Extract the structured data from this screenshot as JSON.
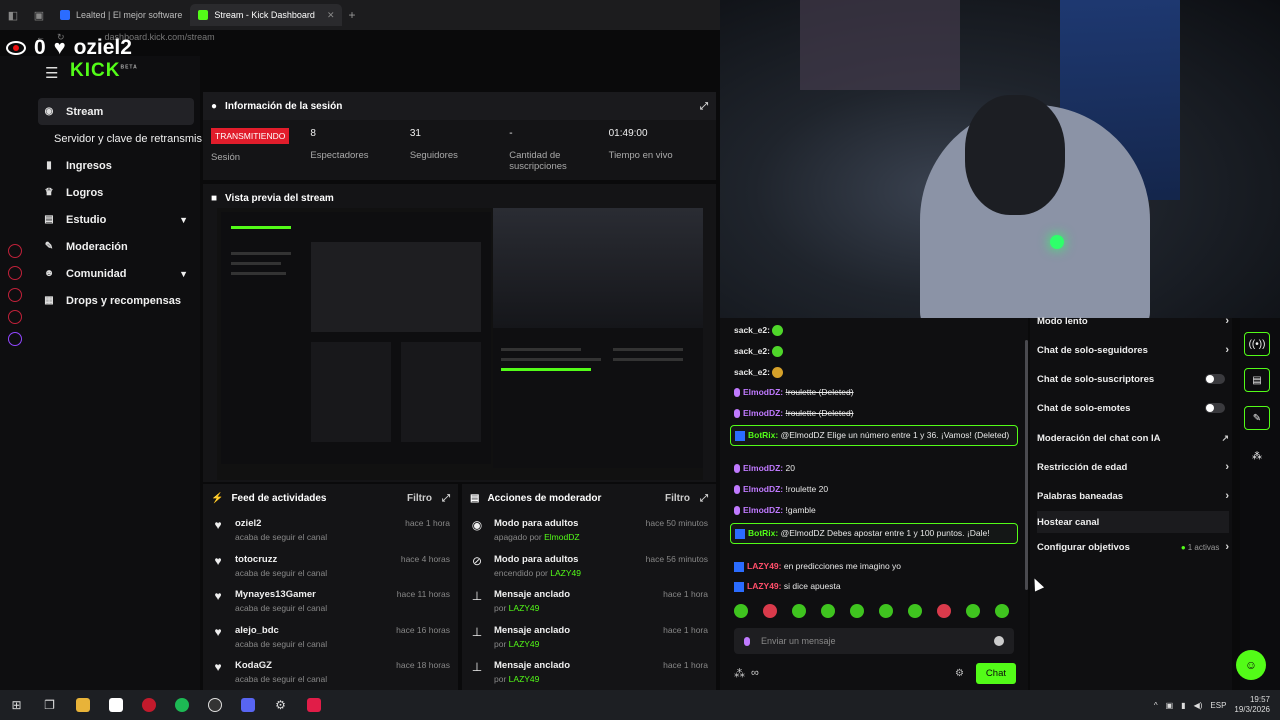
{
  "browser": {
    "tabs": [
      {
        "label": "Lealted | El mejor software"
      },
      {
        "label": "Stream - Kick Dashboard"
      }
    ],
    "new_tab": "+",
    "url": "dashboard.kick.com/stream"
  },
  "overlay": {
    "viewers": "0",
    "username": "oziel2"
  },
  "brand": {
    "logo": "KICK",
    "beta": "BETA"
  },
  "nav": {
    "items": [
      {
        "label": "Stream",
        "icon": "broadcast-icon"
      },
      {
        "label": "Servidor y clave de retransmisión"
      },
      {
        "label": "Ingresos",
        "icon": "chart-icon"
      },
      {
        "label": "Logros",
        "icon": "trophy-icon"
      },
      {
        "label": "Estudio",
        "icon": "studio-icon"
      },
      {
        "label": "Moderación",
        "icon": "wrench-icon"
      },
      {
        "label": "Comunidad",
        "icon": "people-icon"
      },
      {
        "label": "Drops y recompensas",
        "icon": "gift-icon"
      }
    ]
  },
  "session": {
    "title": "Información de la sesión",
    "status": "TRANSMITIENDO",
    "status_label": "Sesión",
    "viewers_value": "8",
    "viewers_label": "Espectadores",
    "followers_value": "31",
    "followers_label": "Seguidores",
    "subs_value": "-",
    "subs_label": "Cantidad de suscripciones",
    "time_value": "01:49:00",
    "time_label": "Tiempo en vivo"
  },
  "preview": {
    "title": "Vista previa del stream"
  },
  "feed": {
    "title": "Feed de actividades",
    "filter": "Filtro",
    "items": [
      {
        "name": "oziel2",
        "action": "acaba de seguir el canal",
        "time": "hace 1 hora"
      },
      {
        "name": "totocruzz",
        "action": "acaba de seguir el canal",
        "time": "hace 4 horas"
      },
      {
        "name": "Mynayes13Gamer",
        "action": "acaba de seguir el canal",
        "time": "hace 11 horas"
      },
      {
        "name": "alejo_bdc",
        "action": "acaba de seguir el canal",
        "time": "hace 16 horas"
      },
      {
        "name": "KodaGZ",
        "action": "acaba de seguir el canal",
        "time": "hace 18 horas"
      }
    ]
  },
  "mod_actions": {
    "title": "Acciones de moderador",
    "filter": "Filtro",
    "items": [
      {
        "name": "Modo para adultos",
        "prefix": "apagado por",
        "by": "ElmodDZ",
        "time": "hace 50 minutos"
      },
      {
        "name": "Modo para adultos",
        "prefix": "encendido por",
        "by": "LAZY49",
        "time": "hace 56 minutos"
      },
      {
        "name": "Mensaje anclado",
        "prefix": "por",
        "by": "LAZY49",
        "time": "hace 1 hora"
      },
      {
        "name": "Mensaje anclado",
        "prefix": "por",
        "by": "LAZY49",
        "time": "hace 1 hora"
      },
      {
        "name": "Mensaje anclado",
        "prefix": "por",
        "by": "LAZY49",
        "time": "hace 1 hora"
      }
    ]
  },
  "chat": {
    "messages": [
      {
        "user": "sack_e2:",
        "text": ""
      },
      {
        "user": "sack_e2:",
        "text": ""
      },
      {
        "user": "sack_e2:",
        "text": ""
      },
      {
        "user": "ElmodDZ:",
        "text": "!roulette (Deleted)"
      },
      {
        "user": "ElmodDZ:",
        "text": "!roulette (Deleted)"
      },
      {
        "user": "BotRix:",
        "text": "@ElmodDZ Elige un número entre 1 y 36. ¡Vamos! (Deleted)"
      },
      {
        "user": "ElmodDZ:",
        "text": "20"
      },
      {
        "user": "ElmodDZ:",
        "text": "!roulette 20"
      },
      {
        "user": "ElmodDZ:",
        "text": "!gamble"
      },
      {
        "user": "BotRix:",
        "text": "@ElmodDZ Debes apostar entre 1 y 100 puntos. ¡Dale!"
      },
      {
        "user": "LAZY49:",
        "text": "en predicciones me imagino yo"
      },
      {
        "user": "LAZY49:",
        "text": "si dice apuesta"
      }
    ],
    "input_placeholder": "Enviar un mensaje",
    "infinity": "∞",
    "send_label": "Chat"
  },
  "settings": {
    "items": [
      {
        "label": "Modo lento"
      },
      {
        "label": "Chat de solo-seguidores"
      },
      {
        "label": "Chat de solo-suscriptores"
      },
      {
        "label": "Chat de solo-emotes"
      },
      {
        "label": "Moderación del chat con IA"
      },
      {
        "label": "Restricción de edad"
      },
      {
        "label": "Palabras baneadas"
      },
      {
        "label": "Hostear canal"
      },
      {
        "label": "Configurar objetivos",
        "tag": "1 activas"
      }
    ]
  },
  "taskbar": {
    "lang": "ESP",
    "time": "19:57",
    "date": "19/3/2026"
  },
  "colors": {
    "brand": "#53fc18",
    "live": "#e11d2b",
    "bg": "#0a0a0b"
  }
}
